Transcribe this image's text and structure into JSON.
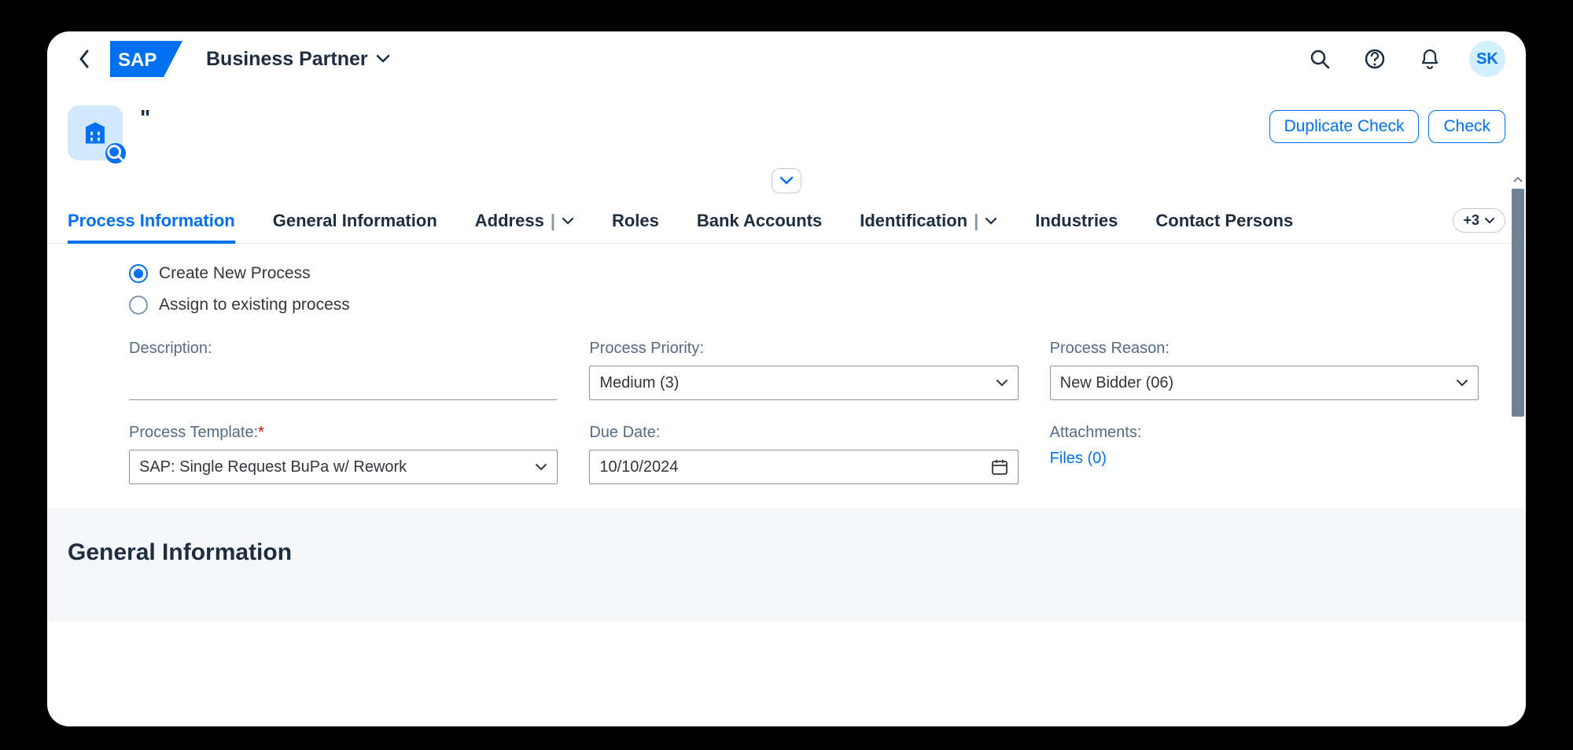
{
  "header": {
    "title": "Business Partner",
    "avatar_initials": "SK"
  },
  "object": {
    "title": "\""
  },
  "actions": {
    "duplicate_check": "Duplicate Check",
    "check": "Check"
  },
  "tabs": [
    {
      "label": "Process Information",
      "active": true,
      "dropdown": false
    },
    {
      "label": "General Information",
      "active": false,
      "dropdown": false
    },
    {
      "label": "Address",
      "active": false,
      "dropdown": true
    },
    {
      "label": "Roles",
      "active": false,
      "dropdown": false
    },
    {
      "label": "Bank Accounts",
      "active": false,
      "dropdown": false
    },
    {
      "label": "Identification",
      "active": false,
      "dropdown": true
    },
    {
      "label": "Industries",
      "active": false,
      "dropdown": false
    },
    {
      "label": "Contact Persons",
      "active": false,
      "dropdown": false
    }
  ],
  "overflow": "+3",
  "radios": {
    "create": "Create New Process",
    "assign": "Assign to existing process"
  },
  "fields": {
    "description_label": "Description:",
    "description_value": "",
    "priority_label": "Process Priority:",
    "priority_value": "Medium (3)",
    "reason_label": "Process Reason:",
    "reason_value": "New Bidder (06)",
    "template_label": "Process Template:",
    "template_value": "SAP: Single Request BuPa w/ Rework",
    "due_label": "Due Date:",
    "due_value": "10/10/2024",
    "attach_label": "Attachments:",
    "attach_link": "Files (0)"
  },
  "section_general": "General Information"
}
